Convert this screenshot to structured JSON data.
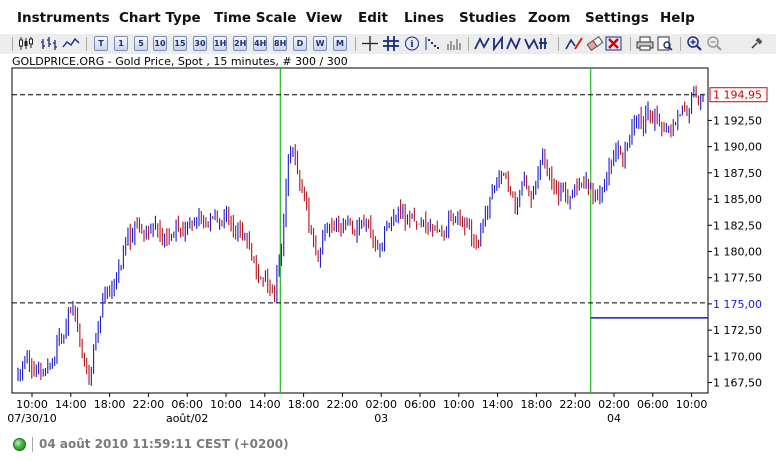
{
  "menu": {
    "items": [
      "Instruments",
      "Chart Type",
      "Time Scale",
      "View",
      "Edit",
      "Lines",
      "Studies",
      "Zoom",
      "Settings",
      "Help"
    ]
  },
  "toolbar": {
    "timeframe_buttons": [
      "T",
      "1",
      "5",
      "10",
      "15",
      "30",
      "1H",
      "2H",
      "4H",
      "8H",
      "D",
      "W",
      "M"
    ],
    "icons": [
      "candlestick-chart-icon",
      "bar-chart-icon",
      "line-chart-icon",
      "crosshair-icon",
      "grid-icon",
      "info-icon",
      "indicator-icon",
      "volume-icon",
      "trend-lines-icon",
      "draw-tools-icon",
      "eraser-icon",
      "delete-icon",
      "print-icon",
      "print-preview-icon",
      "zoom-in-icon",
      "zoom-out-icon",
      "pin-icon"
    ]
  },
  "chart": {
    "title": "GOLDPRICE.ORG - Gold Price, Spot , 15 minutes, # 300 / 300",
    "current_price_label": "1 194,95",
    "reference_price_label": "1 175,00",
    "colors": {
      "up_bar": "#1a1acd",
      "down_bar": "#b5121b",
      "session_line": "#22bb22",
      "reference_line": "#1a1acd",
      "price_box": "#d40000",
      "axis": "#000000"
    }
  },
  "chart_data": {
    "type": "bar",
    "title": "GOLDPRICE.ORG - Gold Price, Spot , 15 minutes, # 300 / 300",
    "interval": "15 minutes",
    "ylim": [
      1166.5,
      1197.5
    ],
    "y_ticks": [
      1167.5,
      1170,
      1172.5,
      1175,
      1177.5,
      1180,
      1182.5,
      1185,
      1187.5,
      1190,
      1192.5
    ],
    "y_tick_labels": [
      "1 167,50",
      "1 170,00",
      "1 172,50",
      "1 175,00",
      "1 177,50",
      "1 180,00",
      "1 182,50",
      "1 185,00",
      "1 187,50",
      "1 190,00",
      "1 192,50"
    ],
    "x_ticks": [
      "10:00",
      "14:00",
      "18:00",
      "22:00",
      "06:00",
      "10:00",
      "14:00",
      "18:00",
      "22:00",
      "02:00",
      "06:00",
      "10:00",
      "14:00",
      "18:00",
      "22:00",
      "02:00",
      "06:00",
      "10:00"
    ],
    "x_date_labels": [
      "07/30/10",
      "août/02",
      "03",
      "04"
    ],
    "x_date_label_under_tick": [
      0,
      4,
      9,
      15
    ],
    "session_breaks_after_tick": [
      6,
      14
    ],
    "current_price": 1194.95,
    "reference_price": 1175.0,
    "price_series": [
      1168.0,
      1168.3,
      1170.2,
      1168.8,
      1168.5,
      1169.0,
      1168.0,
      1168.5,
      1169.2,
      1170.0,
      1172.0,
      1171.0,
      1173.0,
      1175.0,
      1174.0,
      1172.0,
      1170.5,
      1169.0,
      1168.0,
      1171.0,
      1173.0,
      1175.0,
      1176.5,
      1176.0,
      1176.5,
      1178.0,
      1179.0,
      1182.0,
      1181.0,
      1182.5,
      1183.0,
      1181.5,
      1182.0,
      1181.5,
      1182.5,
      1182.0,
      1181.0,
      1182.0,
      1180.5,
      1182.0,
      1182.5,
      1182.0,
      1182.5,
      1183.0,
      1182.5,
      1183.5,
      1183.0,
      1182.5,
      1183.0,
      1183.5,
      1183.0,
      1182.5,
      1183.5,
      1183.0,
      1182.0,
      1182.5,
      1181.5,
      1181.0,
      1180.0,
      1178.5,
      1177.5,
      1178.0,
      1177.0,
      1176.0,
      1175.5,
      1179.0,
      1181.0,
      1187.0,
      1189.5,
      1189.0,
      1187.5,
      1186.0,
      1184.0,
      1182.0,
      1180.0,
      1179.0,
      1181.5,
      1182.0,
      1183.0,
      1182.5,
      1182.0,
      1182.5,
      1183.0,
      1182.5,
      1182.0,
      1182.5,
      1183.0,
      1182.5,
      1182.0,
      1181.0,
      1180.5,
      1181.0,
      1182.5,
      1183.0,
      1183.5,
      1184.0,
      1183.5,
      1183.0,
      1183.5,
      1183.0,
      1182.5,
      1183.0,
      1182.0,
      1182.5,
      1182.0,
      1181.5,
      1182.0,
      1182.5,
      1183.0,
      1182.5,
      1183.0,
      1182.5,
      1183.0,
      1182.0,
      1181.0,
      1180.5,
      1182.5,
      1184.0,
      1185.0,
      1186.5,
      1187.5,
      1188.0,
      1187.0,
      1186.0,
      1184.5,
      1185.5,
      1187.0,
      1186.0,
      1185.0,
      1186.5,
      1187.5,
      1189.0,
      1188.5,
      1187.5,
      1186.0,
      1185.5,
      1186.0,
      1185.0,
      1185.5,
      1186.0,
      1186.5,
      1186.0,
      1186.5,
      1186.0,
      1185.5,
      1185.0,
      1186.0,
      1187.0,
      1188.5,
      1189.5,
      1190.0,
      1189.0,
      1190.5,
      1191.5,
      1192.5,
      1193.0,
      1192.0,
      1193.5,
      1192.5,
      1193.0,
      1192.0,
      1191.5,
      1192.0,
      1191.0,
      1192.5,
      1193.0,
      1193.5,
      1193.0,
      1194.5,
      1195.5,
      1194.5,
      1194.95
    ]
  },
  "status": {
    "timestamp": "04 août 2010 11:59:11  CEST (+0200)",
    "connection_color": "#3cb83a"
  }
}
